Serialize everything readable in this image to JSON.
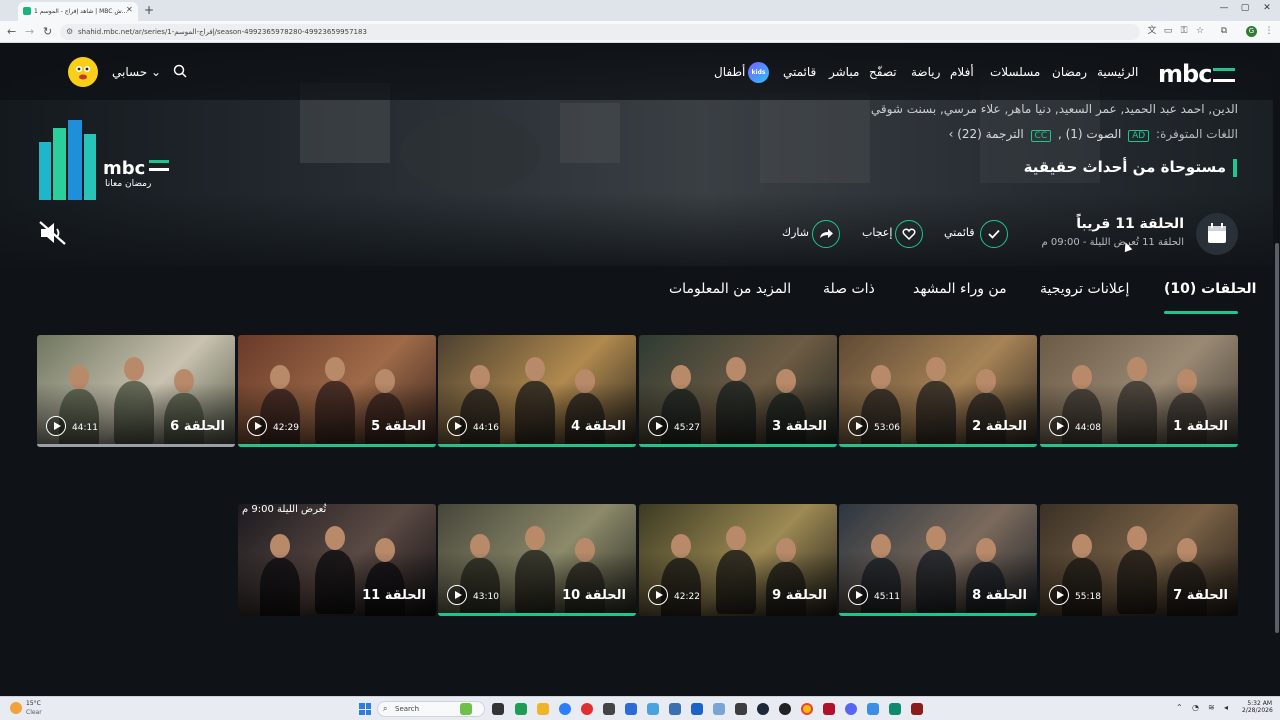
{
  "browser": {
    "tab_title": "شاهد إفراج - الموسم 1 | MBC ش...",
    "new_tab": "+",
    "url": "shahid.mbc.net/ar/series/إفراج-الموسم-1/season-499236597828​0-49923659957183",
    "window_buttons": [
      "—",
      "▢",
      "✕"
    ]
  },
  "nav": {
    "logo": "mbc",
    "items": [
      "الرئيسية",
      "رمضان",
      "مسلسلات",
      "أفلام",
      "رياضة",
      "تصفّح",
      "مباشر",
      "قائمتي",
      "أطفال"
    ],
    "kids_badge": "kids",
    "account": "حسابي ⌄"
  },
  "hero": {
    "cast": "الدين, احمد عبد الحميد, عمر السعيد, دنيا ماهر, علاء مرسي, بسنت شوقي",
    "languages_label": "اللغات المتوفرة:",
    "ad_badge": "AD",
    "audio": "الصوت (1) ,",
    "cc_badge": "CC",
    "subtitles": "الترجمة (22)",
    "subtitles_arrow": "›",
    "inspired": "مستوحاة من أحداث حقيقية",
    "ramadan_logo_text": "رمضان معانا",
    "next_episode_title": "الحلقة 11 قريباً",
    "next_episode_sub": "الحلقة 11 تُعرض الليلة - 09:00 م",
    "actions": [
      {
        "label": "قائمتي",
        "icon": "check-icon"
      },
      {
        "label": "إعجاب",
        "icon": "heart-icon"
      },
      {
        "label": "شارك",
        "icon": "share-icon"
      }
    ]
  },
  "section_tabs": [
    {
      "label": "الحلقات (10)",
      "active": true
    },
    {
      "label": "إعلانات ترويجية",
      "active": false
    },
    {
      "label": "من وراء المشهد",
      "active": false
    },
    {
      "label": "ذات صلة",
      "active": false
    },
    {
      "label": "المزيد من المعلومات",
      "active": false
    }
  ],
  "episodes": [
    {
      "title": "الحلقة 1",
      "duration": "44:08",
      "progress": 1.0
    },
    {
      "title": "الحلقة 2",
      "duration": "53:06",
      "progress": 1.0
    },
    {
      "title": "الحلقة 3",
      "duration": "45:27",
      "progress": 1.0
    },
    {
      "title": "الحلقة 4",
      "duration": "44:16",
      "progress": 1.0
    },
    {
      "title": "الحلقة 5",
      "duration": "42:29",
      "progress": 1.0
    },
    {
      "title": "الحلقة 6",
      "duration": "44:11",
      "progress": 1.0,
      "progress_color": "#9aa0a6"
    },
    {
      "title": "الحلقة 7",
      "duration": "55:18",
      "progress": 0
    },
    {
      "title": "الحلقة 8",
      "duration": "45:11",
      "progress": 1.0
    },
    {
      "title": "الحلقة 9",
      "duration": "42:22",
      "progress": 0
    },
    {
      "title": "الحلقة 10",
      "duration": "43:10",
      "progress": 1.0
    },
    {
      "title": "الحلقة 11",
      "duration": "",
      "progress": 0,
      "airs": "تُعرض الليلة 9:00 م"
    }
  ],
  "taskbar": {
    "weather_temp": "15°C",
    "weather_status": "Clear",
    "search_placeholder": "Search",
    "time": "5:32 AM",
    "date": "2/28/2026"
  },
  "colors": {
    "accent": "#1fc58b",
    "background": "#0f1317"
  }
}
